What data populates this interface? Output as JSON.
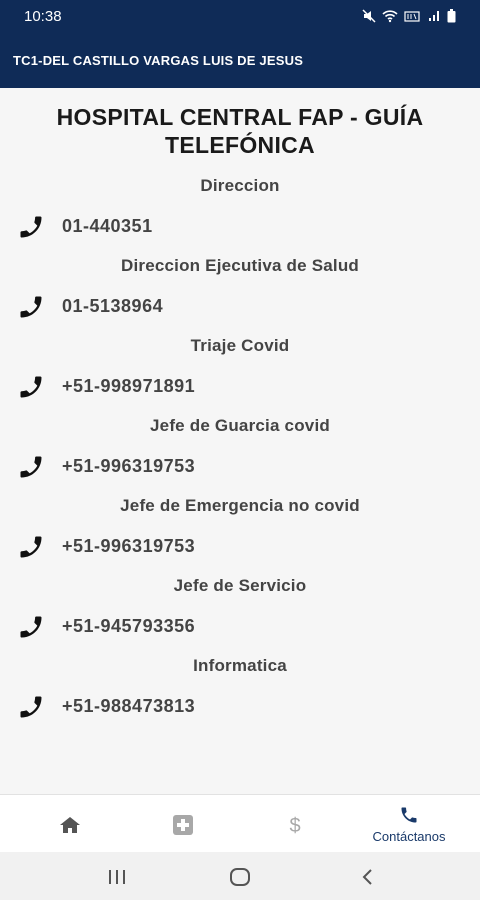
{
  "status_bar": {
    "time": "10:38"
  },
  "app_bar": {
    "title": "TC1-DEL CASTILLO VARGAS LUIS DE JESUS"
  },
  "page": {
    "title": "HOSPITAL CENTRAL FAP - GUÍA TELEFÓNICA",
    "contacts": [
      {
        "name": "Direccion",
        "phone": "01-440351"
      },
      {
        "name": "Direccion Ejecutiva de Salud",
        "phone": "01-5138964"
      },
      {
        "name": "Triaje Covid",
        "phone": "+51-998971891"
      },
      {
        "name": "Jefe de Guarcia covid",
        "phone": "+51-996319753"
      },
      {
        "name": "Jefe de Emergencia no covid",
        "phone": "+51-996319753"
      },
      {
        "name": "Jefe de Servicio",
        "phone": "+51-945793356"
      },
      {
        "name": "Informatica",
        "phone": "+51-988473813"
      }
    ]
  },
  "bottom_nav": {
    "items": [
      {
        "icon": "home-icon",
        "label": ""
      },
      {
        "icon": "medical-cross-icon",
        "label": ""
      },
      {
        "icon": "dollar-icon",
        "label": ""
      },
      {
        "icon": "phone-icon",
        "label": "Contáctanos"
      }
    ],
    "active_color": "#1a3a6a",
    "inactive_color": "#9a9a9a"
  },
  "colors": {
    "app_bar": "#0f2b57",
    "background": "#f6f6f6"
  }
}
